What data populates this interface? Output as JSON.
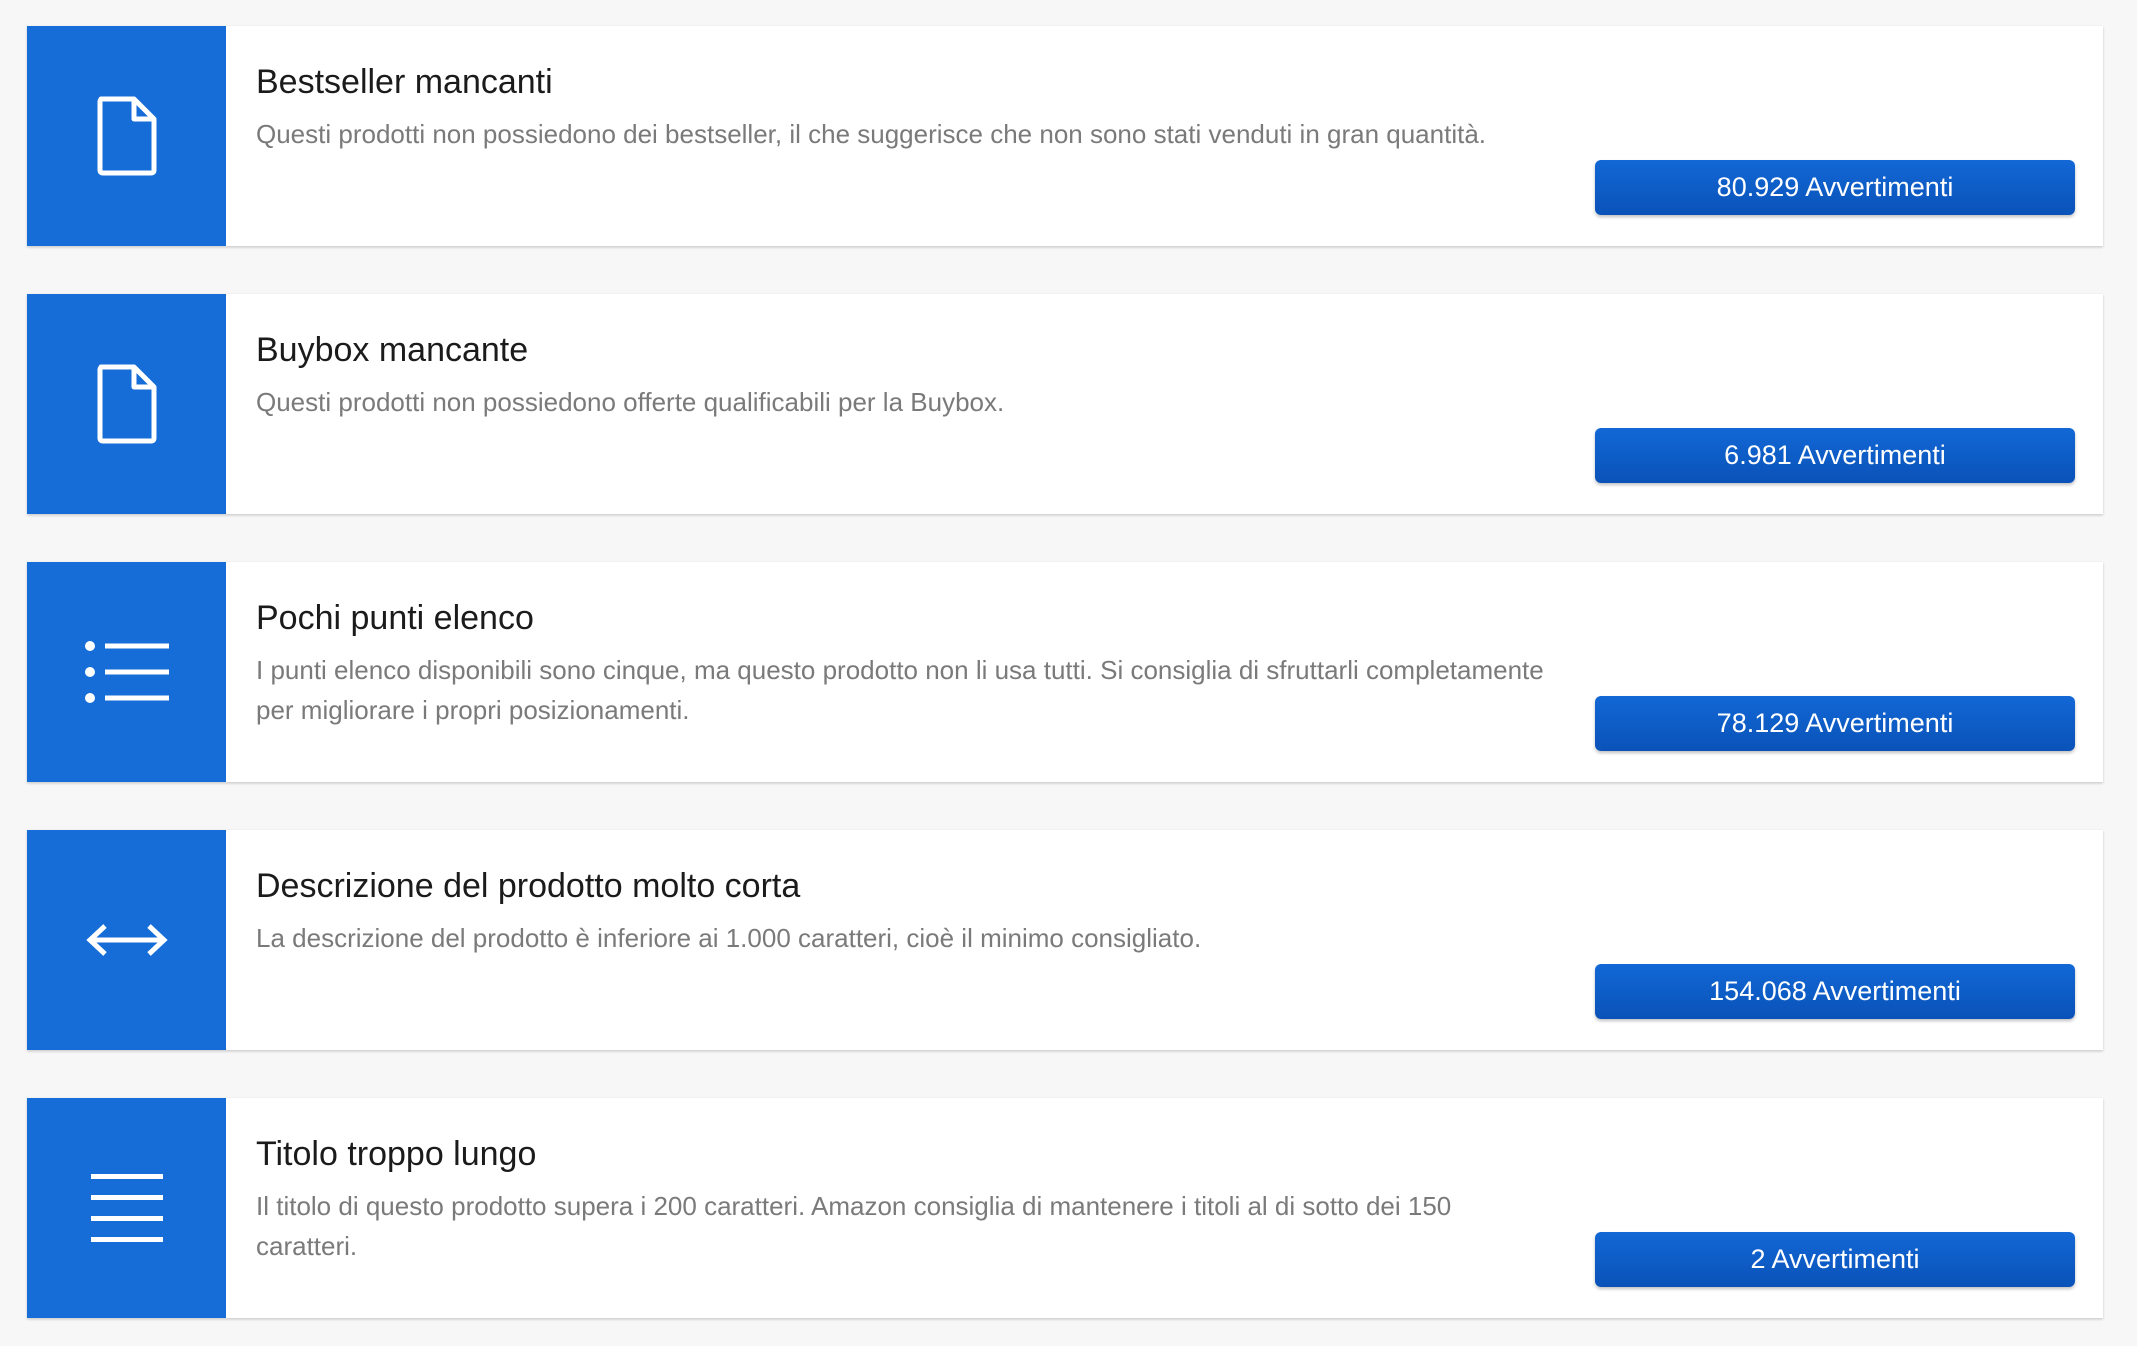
{
  "cards": [
    {
      "icon": "document-icon",
      "title": "Bestseller mancanti",
      "description": "Questi prodotti non possiedono dei bestseller, il che suggerisce che non sono stati venduti in gran quantità.",
      "button_label": "80.929 Avvertimenti"
    },
    {
      "icon": "document-icon",
      "title": "Buybox mancante",
      "description": "Questi prodotti non possiedono offerte qualificabili per la Buybox.",
      "button_label": "6.981 Avvertimenti"
    },
    {
      "icon": "bullet-list-icon",
      "title": "Pochi punti elenco",
      "description": "I punti elenco disponibili sono cinque, ma questo prodotto non li usa tutti. Si consiglia di sfruttarli completamente per migliorare i propri posizionamenti.",
      "button_label": "78.129 Avvertimenti"
    },
    {
      "icon": "double-arrow-icon",
      "title": "Descrizione del prodotto molto corta",
      "description": "La descrizione del prodotto è inferiore ai 1.000 caratteri, cioè il minimo consigliato.",
      "button_label": "154.068 Avvertimenti"
    },
    {
      "icon": "lines-icon",
      "title": "Titolo troppo lungo",
      "description": "Il titolo di questo prodotto supera i 200 caratteri. Amazon consiglia di mantenere i titoli al di sotto dei 150 caratteri.",
      "button_label": "2 Avvertimenti"
    }
  ],
  "colors": {
    "accent": "#166dd8",
    "button": "#0a5cc4",
    "title_text": "#1b1b1b",
    "description_text": "#7a7a7a",
    "background": "#f7f7f7"
  }
}
